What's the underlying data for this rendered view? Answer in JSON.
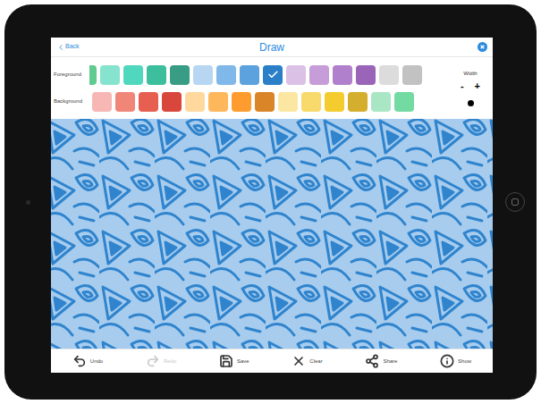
{
  "nav": {
    "back": "Back",
    "title": "Draw"
  },
  "foreground": {
    "label": "Foreground",
    "swatches": [
      {
        "color": "#5fcb8e",
        "selected": false
      },
      {
        "color": "#86e3cd",
        "selected": false
      },
      {
        "color": "#4fd8bd",
        "selected": false
      },
      {
        "color": "#3dbf9d",
        "selected": false
      },
      {
        "color": "#399c84",
        "selected": false
      },
      {
        "color": "#b6d6f1",
        "selected": false
      },
      {
        "color": "#80b8e9",
        "selected": false
      },
      {
        "color": "#5ba2de",
        "selected": false
      },
      {
        "color": "#2a7fc8",
        "selected": true
      },
      {
        "color": "#dcc1e7",
        "selected": false
      },
      {
        "color": "#c69dd9",
        "selected": false
      },
      {
        "color": "#b180cc",
        "selected": false
      },
      {
        "color": "#9a65b8",
        "selected": false
      },
      {
        "color": "#dcdcdc",
        "selected": false
      },
      {
        "color": "#c2c2c2",
        "selected": false
      }
    ]
  },
  "background": {
    "label": "Background",
    "swatches": [
      {
        "color": "#f7b7b4",
        "selected": false
      },
      {
        "color": "#f08677",
        "selected": false
      },
      {
        "color": "#e65f50",
        "selected": false
      },
      {
        "color": "#d9473c",
        "selected": false
      },
      {
        "color": "#ffd89d",
        "selected": false
      },
      {
        "color": "#ffb75b",
        "selected": false
      },
      {
        "color": "#ff9c2f",
        "selected": false
      },
      {
        "color": "#d98528",
        "selected": false
      },
      {
        "color": "#fbe7a1",
        "selected": false
      },
      {
        "color": "#f7d96c",
        "selected": false
      },
      {
        "color": "#f5cc30",
        "selected": false
      },
      {
        "color": "#d4ae2d",
        "selected": false
      },
      {
        "color": "#a9e6c3",
        "selected": false
      },
      {
        "color": "#73dba1",
        "selected": false
      }
    ]
  },
  "width": {
    "label": "Width",
    "minus": "-",
    "plus": "+"
  },
  "toolbar": [
    {
      "label": "Undo",
      "icon": "undo",
      "disabled": false
    },
    {
      "label": "Redo",
      "icon": "redo",
      "disabled": true
    },
    {
      "label": "Save",
      "icon": "save",
      "disabled": false
    },
    {
      "label": "Clear",
      "icon": "clear",
      "disabled": false
    },
    {
      "label": "Share",
      "icon": "share",
      "disabled": false
    },
    {
      "label": "Show",
      "icon": "show",
      "disabled": false
    }
  ]
}
